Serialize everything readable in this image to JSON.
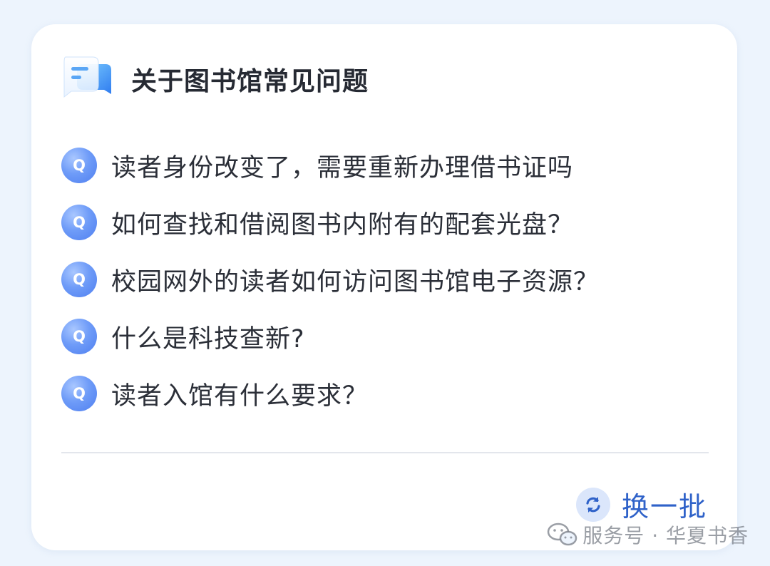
{
  "header": {
    "title": "关于图书馆常见问题",
    "icon": "chat-bubble-icon"
  },
  "faq": {
    "badge_letter": "Q",
    "items": [
      {
        "text": "读者身份改变了，需要重新办理借书证吗"
      },
      {
        "text": "如何查找和借阅图书内附有的配套光盘？"
      },
      {
        "text": "校园网外的读者如何访问图书馆电子资源？"
      },
      {
        "text": "什么是科技查新?"
      },
      {
        "text": "读者入馆有什么要求？"
      }
    ]
  },
  "footer": {
    "refresh_label": "换一批",
    "refresh_icon": "refresh-icon"
  },
  "watermark": {
    "text": "服务号 · 华夏书香",
    "icon": "wechat-icon"
  },
  "colors": {
    "background": "#edf4fd",
    "card": "#ffffff",
    "accent": "#2f62c9",
    "badge": "#5b8cf5"
  }
}
